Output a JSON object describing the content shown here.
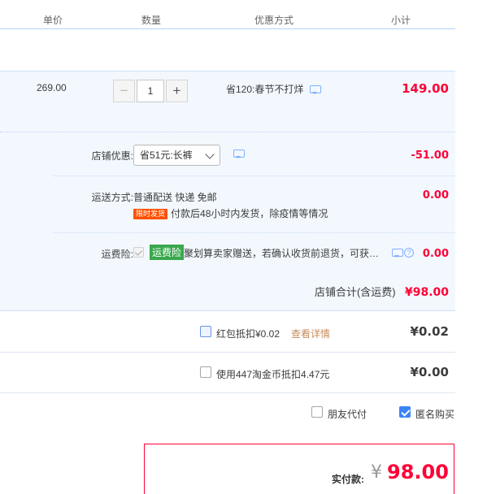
{
  "columns": [
    "单价",
    "数量",
    "优惠方式",
    "小计"
  ],
  "item": {
    "price": "269.00",
    "qty_minus": "−",
    "qty_value": "1",
    "qty_plus": "+",
    "promo_text": "省120:春节不打烊",
    "subtotal": "149.00"
  },
  "shop": {
    "discount_label": "店铺优惠:",
    "discount_selected": "省51元:长裤",
    "discount_amount": "-51.00",
    "shipping_label": "运送方式:",
    "shipping_method": "普通配送 快递 免邮",
    "shipping_tag": "限时发货",
    "shipping_note": "付款后48小时内发货，除疫情等情况",
    "shipping_amount": "0.00",
    "insurance_label": "运费险:",
    "insurance_tag": "运费险",
    "insurance_desc": "聚划算卖家赠送，若确认收货前退货，可获…",
    "insurance_amount": "0.00",
    "total_label": "店铺合计(含运费)",
    "total_value": "¥98.00"
  },
  "redpacket": {
    "text": "红包抵扣¥0.02",
    "link": "查看详情",
    "amount": "¥0.02"
  },
  "taojinbi": {
    "text": "使用447淘金币抵扣4.47元",
    "amount": "¥0.00"
  },
  "options": {
    "friend_pay": "朋友代付",
    "anonymous": "匿名购买"
  },
  "payment": {
    "label": "实付款:",
    "currency": "¥",
    "amount": "98.00"
  },
  "colors": {
    "accent_red": "#ff0036",
    "highlight_bg": "#f3f8ff",
    "green_tag": "#3aa84e",
    "checkbox_blue": "#3a84f6"
  }
}
